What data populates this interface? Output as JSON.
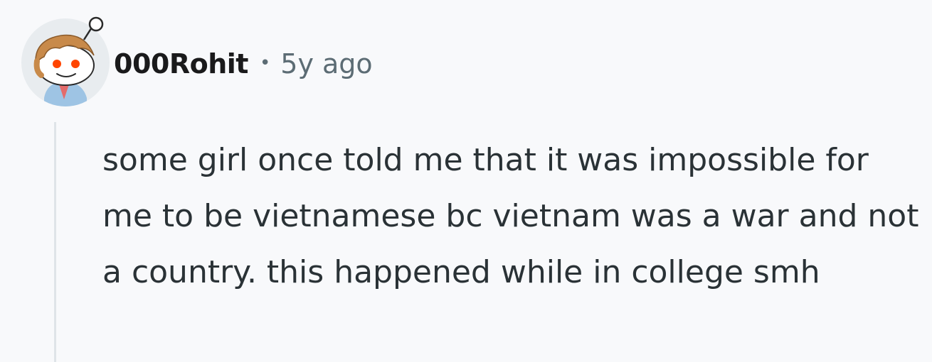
{
  "comment": {
    "author": "000Rohit",
    "separator": "•",
    "timestamp": "5y ago",
    "body": "some girl once told me that it was impossible for me to be vietnamese bc vietnam was a war and not a country. this happened while in college smh"
  },
  "icons": {
    "avatar": "reddit-snoo-avatar-icon"
  },
  "colors": {
    "background": "#f8f9fb",
    "author": "#1a1a1b",
    "meta": "#5c6c74",
    "body_text": "#2a3236",
    "thread_line": "#dfe4e8"
  }
}
